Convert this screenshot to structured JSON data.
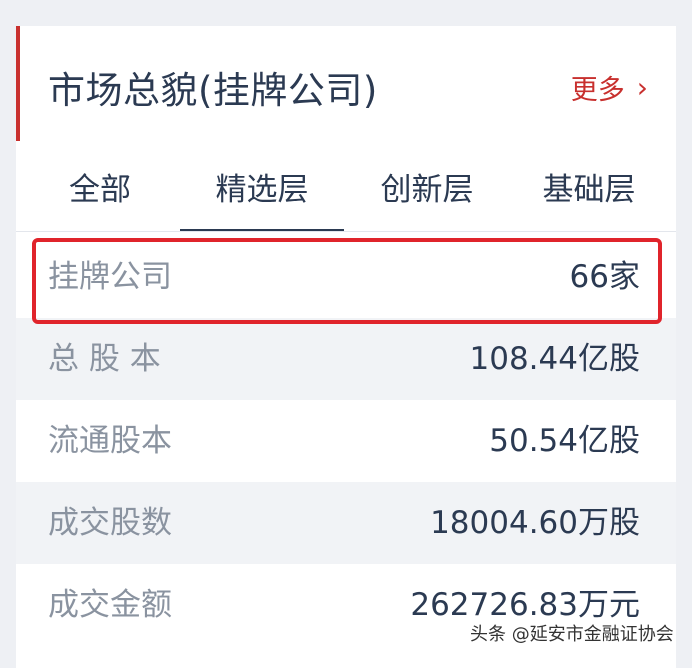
{
  "header": {
    "title": "市场总貌(挂牌公司)",
    "more_label": "更多"
  },
  "tabs": [
    {
      "label": "全部",
      "active": false
    },
    {
      "label": "精选层",
      "active": true
    },
    {
      "label": "创新层",
      "active": false
    },
    {
      "label": "基础层",
      "active": false
    }
  ],
  "rows": [
    {
      "label": "挂牌公司",
      "value": "66家",
      "highlighted": true
    },
    {
      "label": "总 股 本",
      "value": "108.44亿股"
    },
    {
      "label": "流通股本",
      "value": "50.54亿股"
    },
    {
      "label": "成交股数",
      "value": "18004.60万股"
    },
    {
      "label": "成交金额",
      "value": "262726.83万元"
    }
  ],
  "watermark": "头条 @延安市金融证协会",
  "colors": {
    "accent": "#c8302e",
    "highlight_border": "#e0242b",
    "text": "#2b3a52",
    "label_text": "#8a93a0"
  },
  "icons": {
    "more": "chevron-right-icon"
  }
}
